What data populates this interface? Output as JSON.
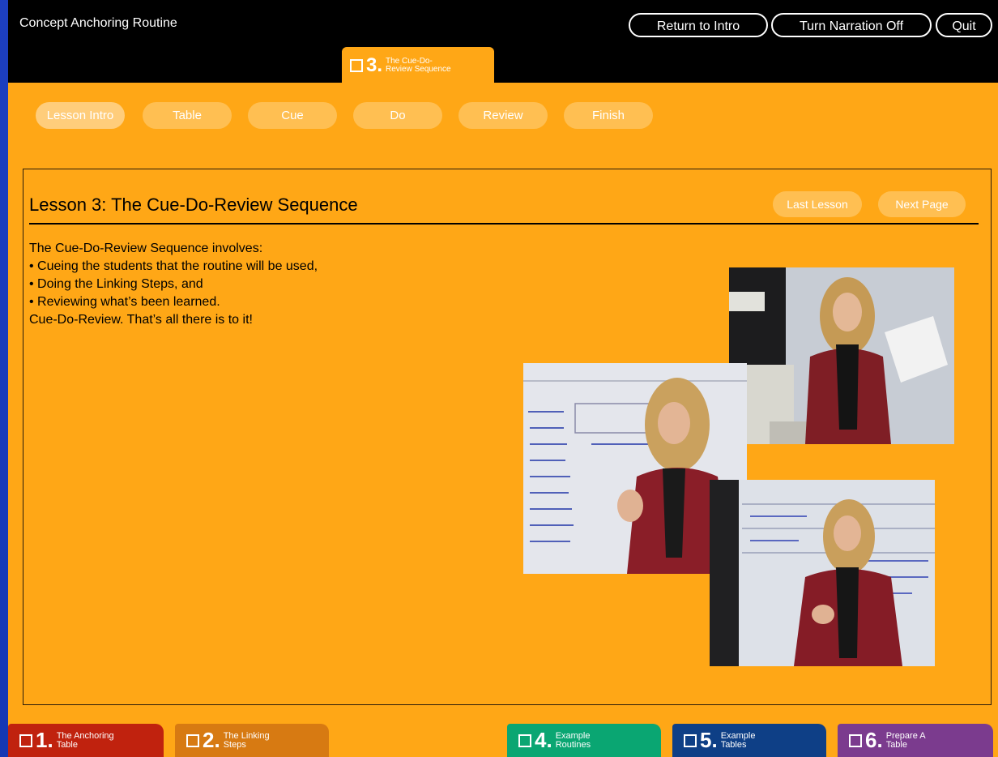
{
  "app": {
    "title": "Concept Anchoring Routine"
  },
  "header_buttons": {
    "return": "Return to Intro",
    "narration": "Turn Narration Off",
    "quit": "Quit"
  },
  "current_tab": {
    "number": "3.",
    "label_line1": "The Cue-Do-",
    "label_line2": "Review Sequence"
  },
  "subnav": [
    "Lesson Intro",
    "Table",
    "Cue",
    "Do",
    "Review",
    "Finish"
  ],
  "lesson": {
    "title": "Lesson 3: The Cue-Do-Review Sequence",
    "last_button": "Last Lesson",
    "next_button": "Next Page",
    "lines": [
      "The Cue-Do-Review Sequence involves:",
      "• Cueing the students that the routine will be used,",
      "• Doing the Linking Steps, and",
      "• Reviewing what’s been learned.",
      "Cue-Do-Review. That’s all there is to it!"
    ]
  },
  "bottom_tabs": [
    {
      "number": "1.",
      "line1": "The Anchoring",
      "line2": "Table",
      "color": "#c0220e"
    },
    {
      "number": "2.",
      "line1": "The Linking",
      "line2": "Steps",
      "color": "#d77a12"
    },
    {
      "number": "4.",
      "line1": "Example",
      "line2": "Routines",
      "color": "#0aa672"
    },
    {
      "number": "5.",
      "line1": "Example",
      "line2": "Tables",
      "color": "#0e3f86"
    },
    {
      "number": "6.",
      "line1": "Prepare A",
      "line2": "Table",
      "color": "#7b3b8e"
    }
  ],
  "colors": {
    "background": "#ffa716",
    "header": "#000000",
    "subnav_button": "#ffbf52"
  },
  "images": [
    "teacher-holding-paper-photo",
    "teacher-at-whiteboard-photo",
    "teacher-gesturing-photo"
  ]
}
